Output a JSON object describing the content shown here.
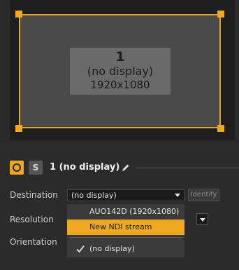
{
  "preview": {
    "display_number": "1",
    "display_name": "(no display)",
    "display_resolution": "1920x1080"
  },
  "output": {
    "solo_label": "S",
    "title": "1 (no display)"
  },
  "fields": {
    "destination_label": "Destination",
    "resolution_label": "Resolution",
    "orientation_label": "Orientation",
    "destination_value": "(no display)",
    "identify_label": "Identify"
  },
  "dropdown": {
    "items": [
      {
        "label": "AUO142D (1920x1080)"
      },
      {
        "label": "New NDI stream"
      },
      {
        "label": "(no display)"
      }
    ],
    "highlighted_index": 1,
    "checked_index": 2
  },
  "colors": {
    "accent": "#f0a820",
    "background": "#2b2b2b"
  },
  "icons": {
    "edit": "pencil-icon",
    "selected": "check-icon"
  }
}
